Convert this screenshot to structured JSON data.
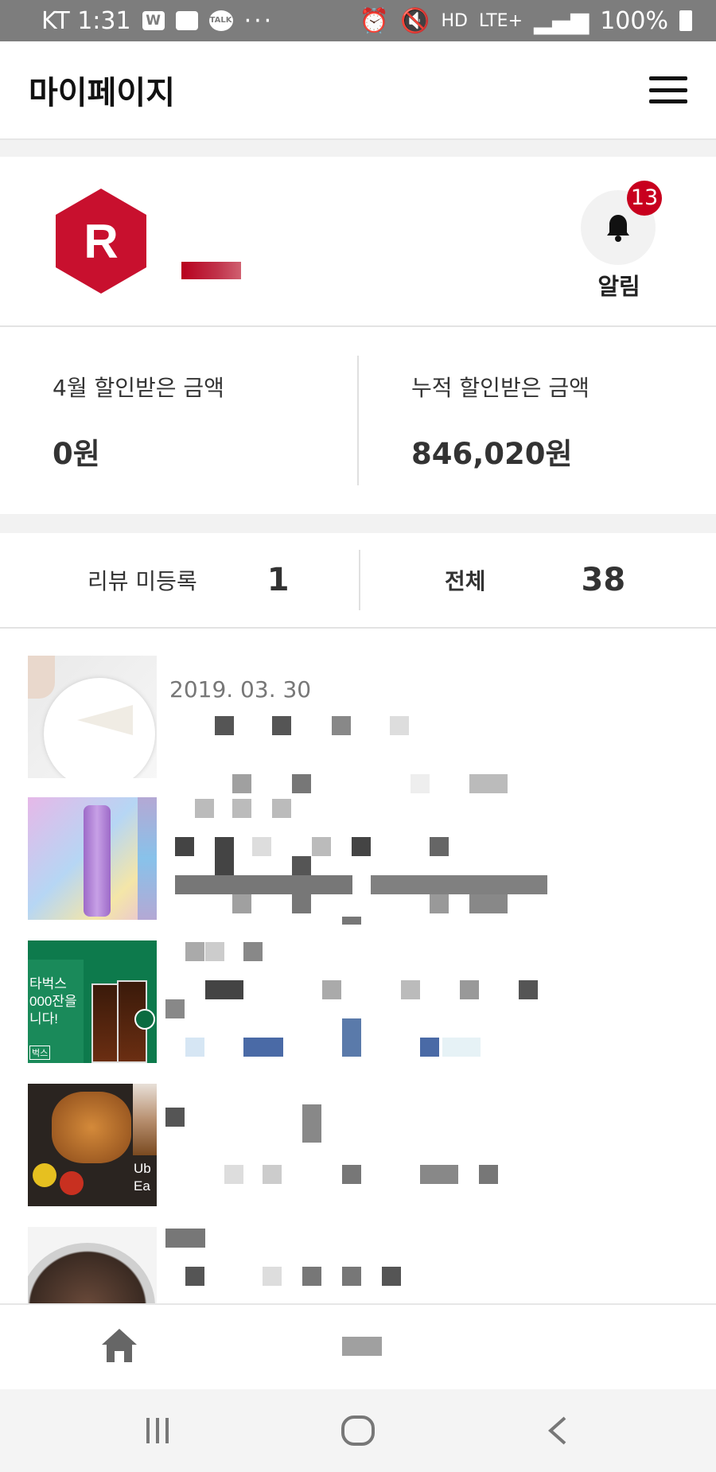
{
  "status_bar": {
    "carrier_time": "KT 1:31",
    "app_icon_w": "W",
    "app_icon_talk": "TALK",
    "more": "···",
    "hd": "HD",
    "network": "LTE+",
    "battery": "100%"
  },
  "header": {
    "title": "마이페이지",
    "menu_icon": "hamburger-menu-icon"
  },
  "profile": {
    "logo_letter": "R",
    "brand_color": "#c8102e",
    "notification_count": "13",
    "notification_label": "알림"
  },
  "discount": {
    "monthly_label": "4월 할인받은 금액",
    "monthly_value": "0원",
    "total_label": "누적 할인받은 금액",
    "total_value": "846,020원"
  },
  "review_stats": {
    "unregistered_label": "리뷰 미등록",
    "unregistered_count": "1",
    "all_label": "전체",
    "all_count": "38"
  },
  "items": [
    {
      "date": "2019. 03. 30"
    },
    {
      "date": ""
    },
    {
      "date": "",
      "thumb_text": [
        "타벅스",
        "000잔을",
        "니다!",
        "벅스"
      ]
    },
    {
      "date": "",
      "thumb_text": [
        "Ub",
        "Ea"
      ]
    },
    {
      "date": ""
    }
  ],
  "icons": {
    "home": "home-icon",
    "recents": "recents-icon",
    "system_home": "system-home-icon",
    "back": "back-icon"
  }
}
